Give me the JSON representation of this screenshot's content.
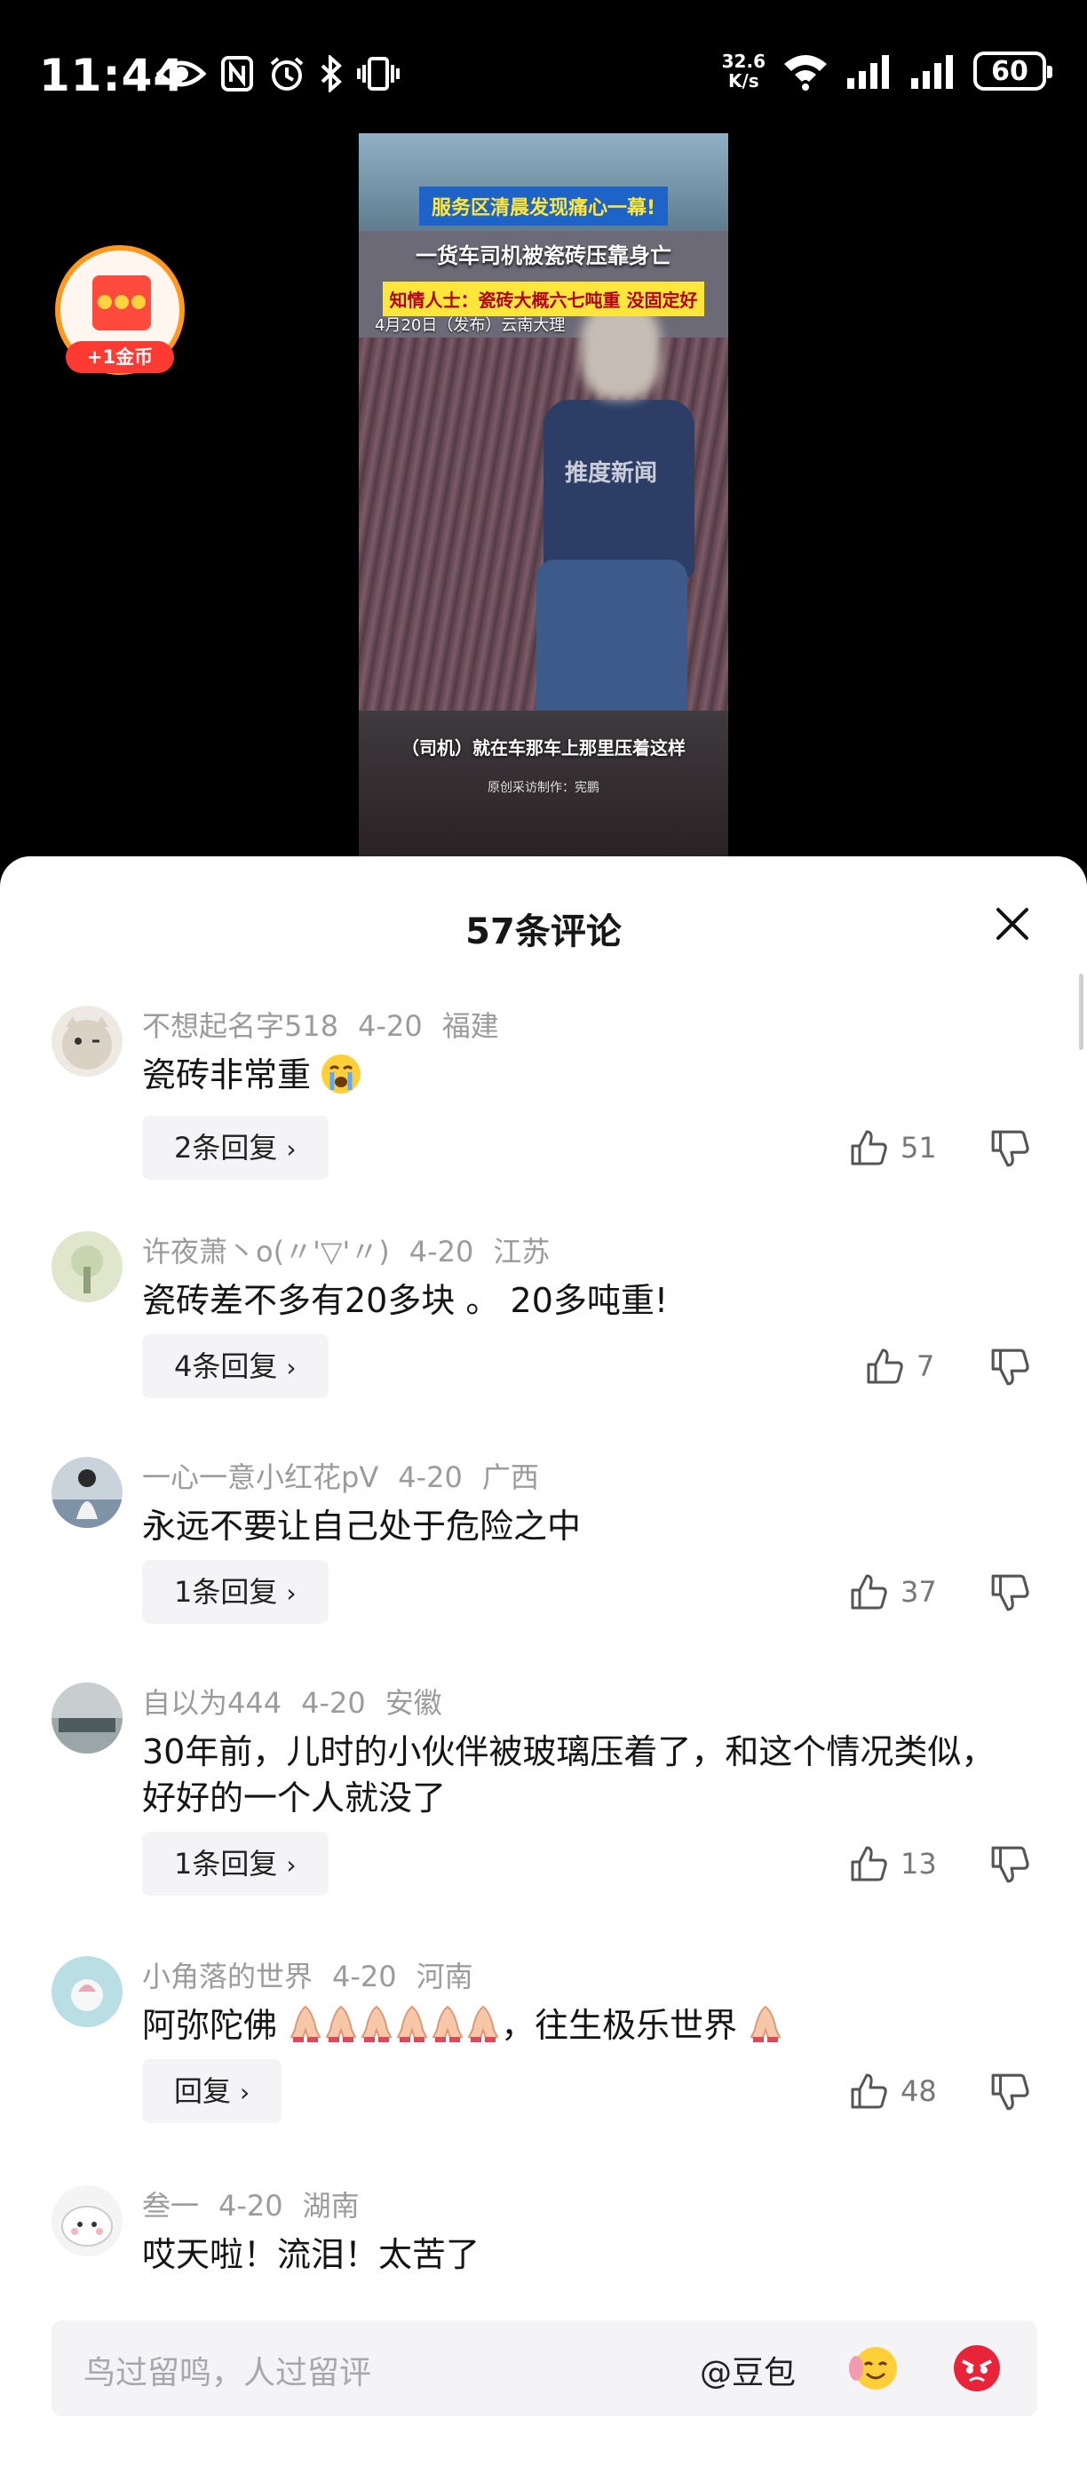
{
  "status_bar": {
    "time": "11:44",
    "net_speed_value": "32.6",
    "net_speed_unit": "K/s",
    "battery": "60"
  },
  "coin_badge": {
    "label": "+1金币"
  },
  "video": {
    "headline_1": "服务区清晨发现痛心一幕!",
    "headline_2": "一货车司机被瓷砖压靠身亡",
    "headline_3": "知情人士：瓷砖大概六七吨重 没固定好",
    "date_place": "4月20日（发布）云南大理",
    "watermark": "推度新闻",
    "subtitle": "（司机）就在车那车上那里压着这样",
    "credit": "原创采访制作：宪鹏"
  },
  "sheet": {
    "title": "57条评论"
  },
  "comments": [
    {
      "user": "不想起名字518",
      "date": "4-20",
      "region": "福建",
      "text": "瓷砖非常重",
      "reply_label": "2条回复",
      "likes": "51"
    },
    {
      "user": "许夜萧丶o(〃'▽'〃)",
      "date": "4-20",
      "region": "江苏",
      "text": "瓷砖差不多有20多块 。 20多吨重!",
      "reply_label": "4条回复",
      "likes": "7"
    },
    {
      "user": "一心一意小红花pV",
      "date": "4-20",
      "region": "广西",
      "text": "永远不要让自己处于危险之中",
      "reply_label": "1条回复",
      "likes": "37"
    },
    {
      "user": "自以为444",
      "date": "4-20",
      "region": "安徽",
      "text": "30年前，儿时的小伙伴被玻璃压着了，和这个情况类似，好好的一个人就没了",
      "reply_label": "1条回复",
      "likes": "13"
    },
    {
      "user": "小角落的世界",
      "date": "4-20",
      "region": "河南",
      "text_a": "阿弥陀佛",
      "text_b": "，往生极乐世界",
      "reply_label": "回复",
      "likes": "48"
    },
    {
      "user": "叁一",
      "date": "4-20",
      "region": "湖南",
      "text": "哎天啦！流泪！太苦了"
    }
  ],
  "input_bar": {
    "placeholder": "鸟过留鸣，人过留评",
    "mention": "@豆包"
  },
  "colors": {
    "accent_orange": "#ff9a1f",
    "coin_red": "#ff3a32",
    "meta_gray": "#9b9b9b"
  }
}
